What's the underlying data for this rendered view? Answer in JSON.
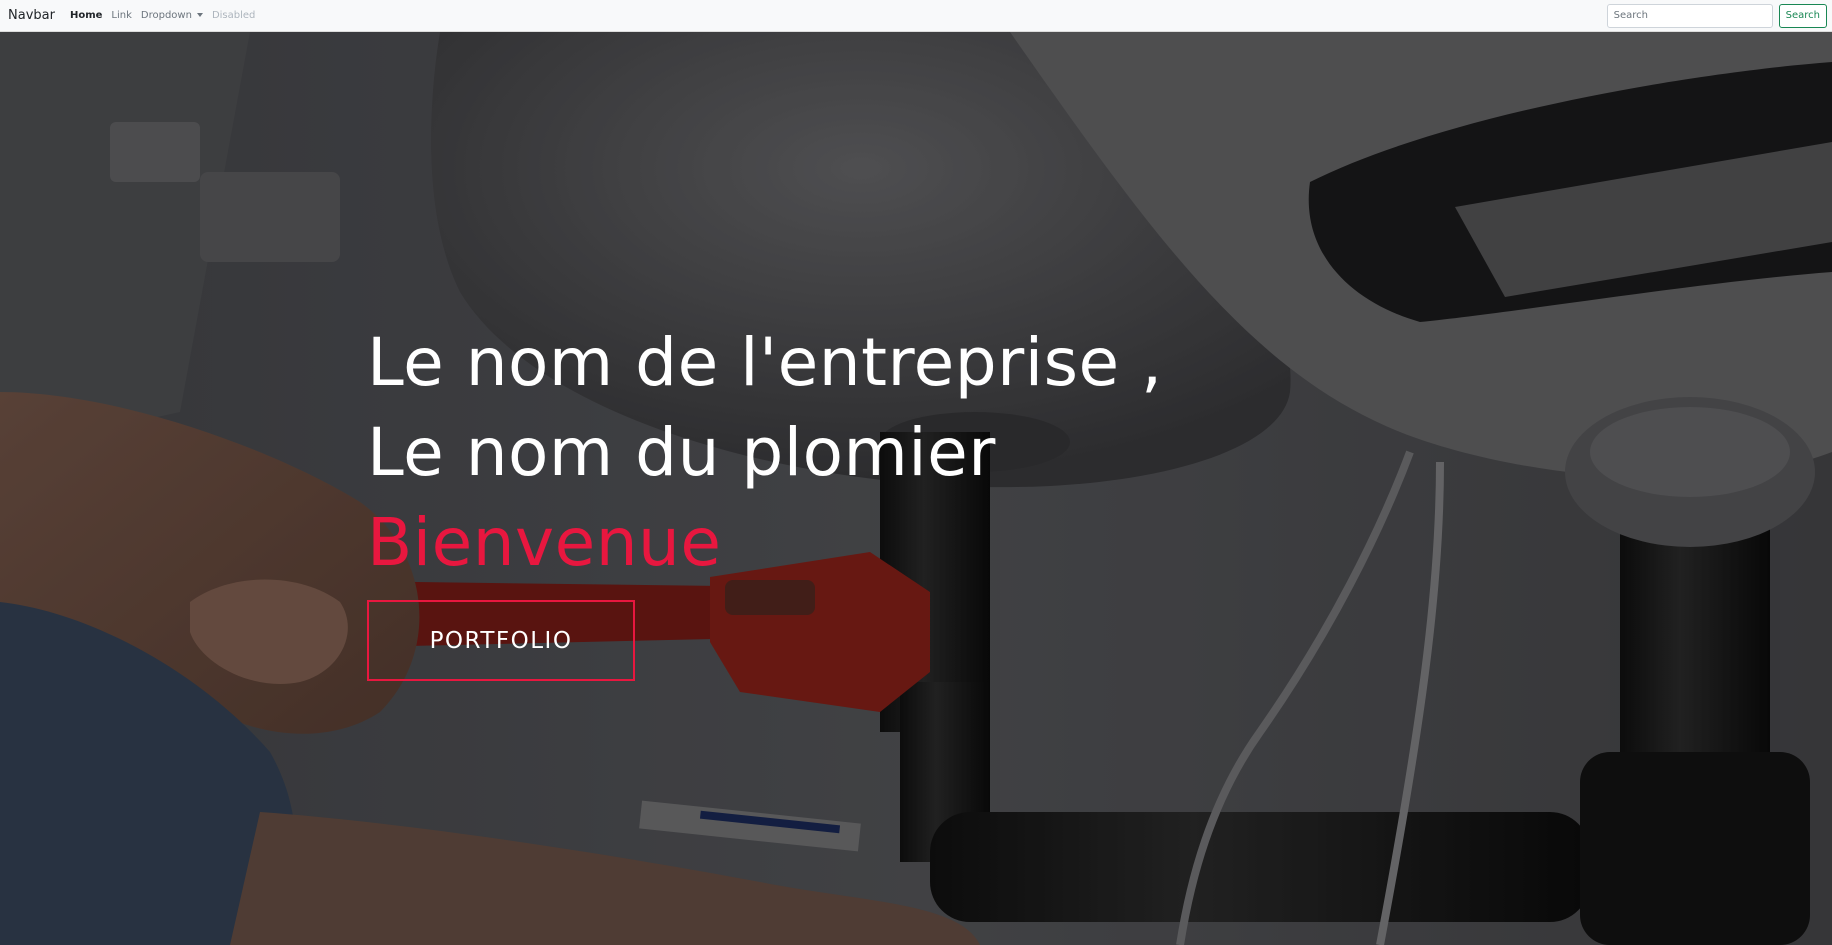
{
  "navbar": {
    "brand": "Navbar",
    "links": [
      {
        "label": "Home",
        "state": "active"
      },
      {
        "label": "Link",
        "state": "normal"
      },
      {
        "label": "Dropdown",
        "state": "dropdown"
      },
      {
        "label": "Disabled",
        "state": "disabled"
      }
    ],
    "search": {
      "placeholder": "Search",
      "value": "",
      "button_label": "Search"
    }
  },
  "hero": {
    "title_line_1": "Le nom de l'entreprise ,",
    "title_line_2": "Le nom du plomier",
    "welcome": "Bienvenue",
    "button_label": "PORTFOLIO",
    "background": "photo-plumber-wrench-sink-pipes"
  },
  "colors": {
    "accent": "#e8173f",
    "navbar_bg": "#f8f9fa",
    "search_button": "#198754"
  }
}
